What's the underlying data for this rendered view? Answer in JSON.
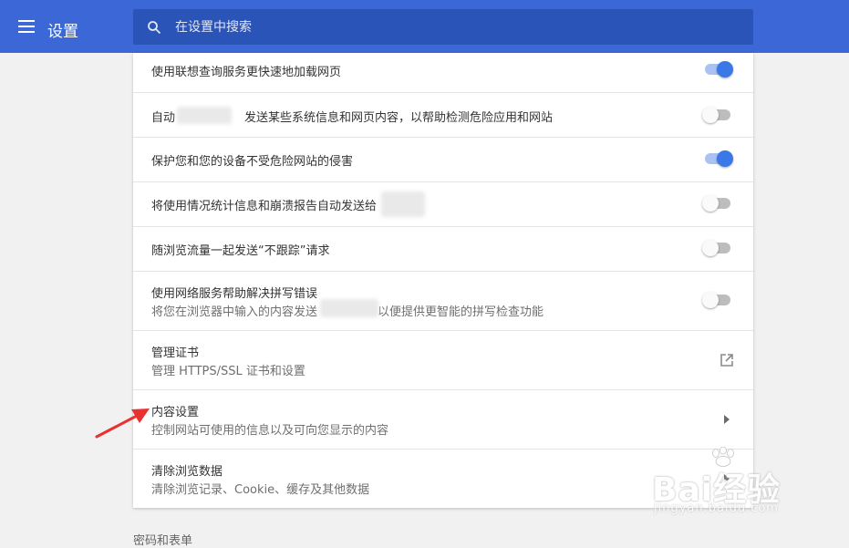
{
  "header": {
    "title": "设置",
    "menu_icon": "hamburger-menu-icon",
    "search_icon": "search-icon",
    "search_placeholder": "在设置中搜索",
    "accent_color": "#3b68d6"
  },
  "settings": {
    "rows": [
      {
        "label": "使用联想查询服务更快速地加载网页",
        "toggle": "on"
      },
      {
        "label_before": "自动",
        "label_after": "发送某些系统信息和网页内容，以帮助检测危险应用和网站",
        "toggle": "off"
      },
      {
        "label": "保护您和您的设备不受危险网站的侵害",
        "toggle": "on"
      },
      {
        "label": "将使用情况统计信息和崩溃报告自动发送给",
        "toggle": "off"
      },
      {
        "label": "随浏览流量一起发送“不跟踪”请求",
        "toggle": "off"
      },
      {
        "label": "使用网络服务帮助解决拼写错误",
        "sub_before": "将您在浏览器中输入的内容发送",
        "sub_after": "以便提供更智能的拼写检查功能",
        "toggle": "off"
      },
      {
        "label": "管理证书",
        "sub": "管理 HTTPS/SSL 证书和设置",
        "icon": "open-in-new-icon"
      },
      {
        "label": "内容设置",
        "sub": "控制网站可使用的信息以及可向您显示的内容",
        "icon": "chevron-right-icon"
      },
      {
        "label": "清除浏览数据",
        "sub": "清除浏览记录、Cookie、缓存及其他数据",
        "icon": "chevron-right-icon"
      }
    ]
  },
  "next_section": "密码和表单",
  "annotation": {
    "icon": "red-arrow-icon",
    "color": "#e8322f"
  },
  "watermark": {
    "text": "Bai经验",
    "url": "jingyan.baidu.com",
    "icon": "baidu-paw-icon"
  },
  "colors": {
    "toggle_on": "#3b78e7",
    "toggle_off": "#bdbdbd"
  }
}
